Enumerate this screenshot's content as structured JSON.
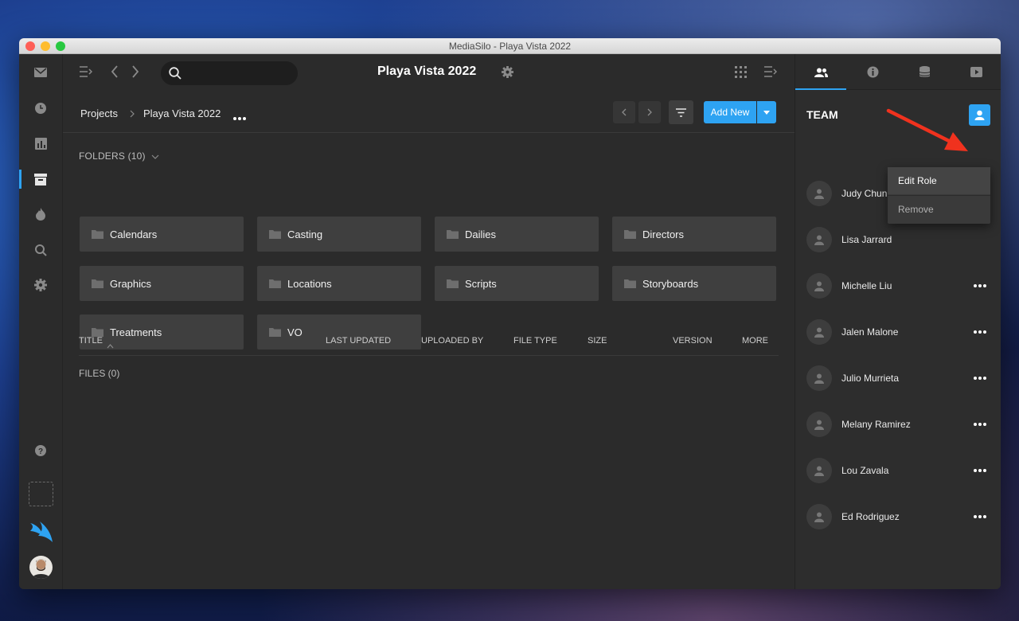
{
  "window": {
    "title": "MediaSilo - Playa Vista 2022"
  },
  "topbar": {
    "title": "Playa Vista 2022",
    "search_placeholder": ""
  },
  "breadcrumb": {
    "items": [
      "Projects",
      "Playa Vista 2022"
    ]
  },
  "toolbar": {
    "add_new_label": "Add New"
  },
  "folders": {
    "header": "FOLDERS (10)",
    "items": [
      "Calendars",
      "Casting",
      "Dailies",
      "Directors",
      "Graphics",
      "Locations",
      "Scripts",
      "Storyboards",
      "Treatments",
      "VO"
    ]
  },
  "table": {
    "columns": [
      "TITLE",
      "LAST UPDATED",
      "UPLOADED BY",
      "FILE TYPE",
      "SIZE",
      "VERSION",
      "MORE"
    ],
    "files_label": "FILES (0)"
  },
  "team": {
    "title": "TEAM",
    "members": [
      "Judy Chun",
      "Lisa Jarrard",
      "Michelle Liu",
      "Jalen Malone",
      "Julio Murrieta",
      "Melany Ramirez",
      "Lou Zavala",
      "Ed Rodriguez"
    ]
  },
  "context_menu": {
    "items": [
      "Edit Role",
      "Remove"
    ]
  },
  "colors": {
    "accent": "#2ea3f2",
    "annotation_arrow": "#f0321e"
  }
}
